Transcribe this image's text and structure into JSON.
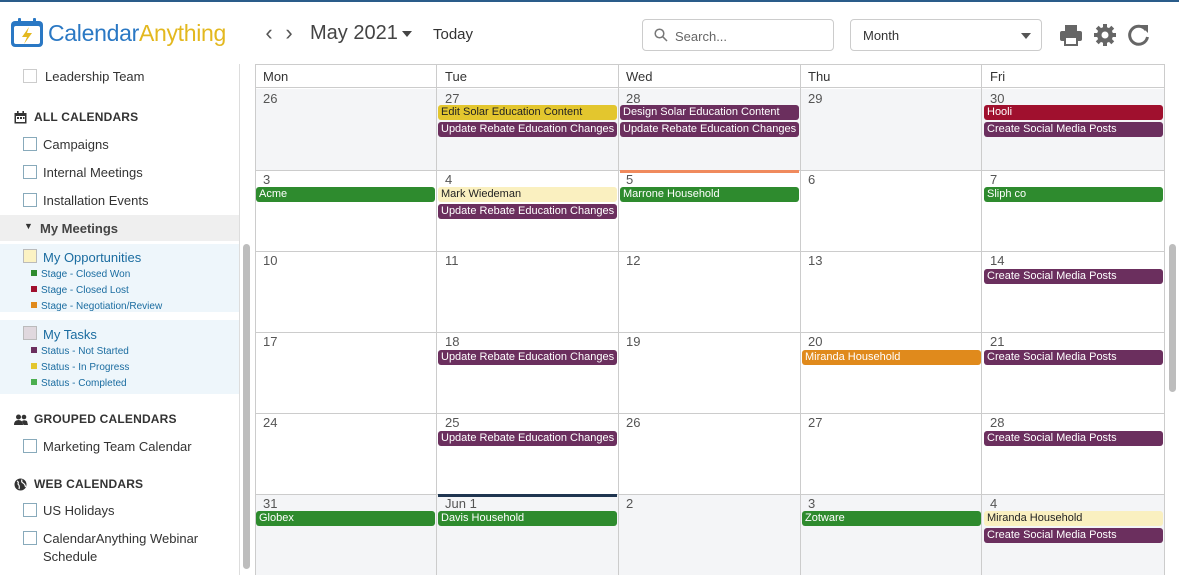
{
  "app": {
    "logo_part1": "Calendar",
    "logo_part2": "Anything"
  },
  "toolbar": {
    "month_label": "May 2021",
    "today_label": "Today",
    "search_placeholder": "Search...",
    "view_value": "Month"
  },
  "sidebar": {
    "leadership": "Leadership Team",
    "all_calendars_title": "ALL CALENDARS",
    "campaigns": "Campaigns",
    "internal_meetings": "Internal Meetings",
    "installation_events": "Installation Events",
    "my_meetings": "My Meetings",
    "my_opportunities": "My Opportunities",
    "opp_legend": [
      {
        "label": "Stage - Closed Won",
        "color": "#2e8b2e"
      },
      {
        "label": "Stage - Closed Lost",
        "color": "#a0102e"
      },
      {
        "label": "Stage - Negotiation/Review",
        "color": "#e08a1c"
      }
    ],
    "my_tasks": "My Tasks",
    "task_legend": [
      {
        "label": "Status - Not Started",
        "color": "#6b2f5e"
      },
      {
        "label": "Status - In Progress",
        "color": "#e3c62e"
      },
      {
        "label": "Status - Completed",
        "color": "#4caf50"
      }
    ],
    "grouped_title": "GROUPED CALENDARS",
    "marketing": "Marketing Team Calendar",
    "web_title": "WEB CALENDARS",
    "us_holidays": "US Holidays",
    "webinar_line1": "CalendarAnything Webinar",
    "webinar_line2": "Schedule"
  },
  "calendar": {
    "days_of_week": [
      "Mon",
      "Tue",
      "Wed",
      "Thu",
      "Fri"
    ],
    "weeks": [
      [
        "26",
        "27",
        "28",
        "29",
        "30"
      ],
      [
        "3",
        "4",
        "5",
        "6",
        "7"
      ],
      [
        "10",
        "11",
        "12",
        "13",
        "14"
      ],
      [
        "17",
        "18",
        "19",
        "20",
        "21"
      ],
      [
        "24",
        "25",
        "26",
        "27",
        "28"
      ],
      [
        "31",
        "Jun 1",
        "2",
        "3",
        "4"
      ]
    ],
    "events": {
      "e1": "Edit Solar Education Content",
      "e2": "Design Solar Education Content",
      "e3": "Hooli",
      "e4": "Update Rebate Education Changes",
      "e5": "Update Rebate Education Changes",
      "e6": "Create Social Media Posts",
      "e7": "Acme",
      "e8": "Mark Wiedeman",
      "e9": "Marrone Household",
      "e10": "Sliph co",
      "e11": "Update Rebate Education Changes",
      "e12": "Create Social Media Posts",
      "e13": "Update Rebate Education Changes",
      "e14": "Miranda Household",
      "e15": "Create Social Media Posts",
      "e16": "Update Rebate Education Changes",
      "e17": "Create Social Media Posts",
      "e18": "Globex",
      "e19": "Davis Household",
      "e20": "Zotware",
      "e21": "Miranda Household",
      "e22": "Create Social Media Posts"
    }
  },
  "colors": {
    "task_purple": "#6b2f5e",
    "in_progress_yellow": "#e3c62e",
    "closed_won_green": "#2e8b2e",
    "closed_lost_red": "#a0102e",
    "negotiation_orange": "#e08a1c",
    "pale_yellow": "#faf0c0"
  }
}
